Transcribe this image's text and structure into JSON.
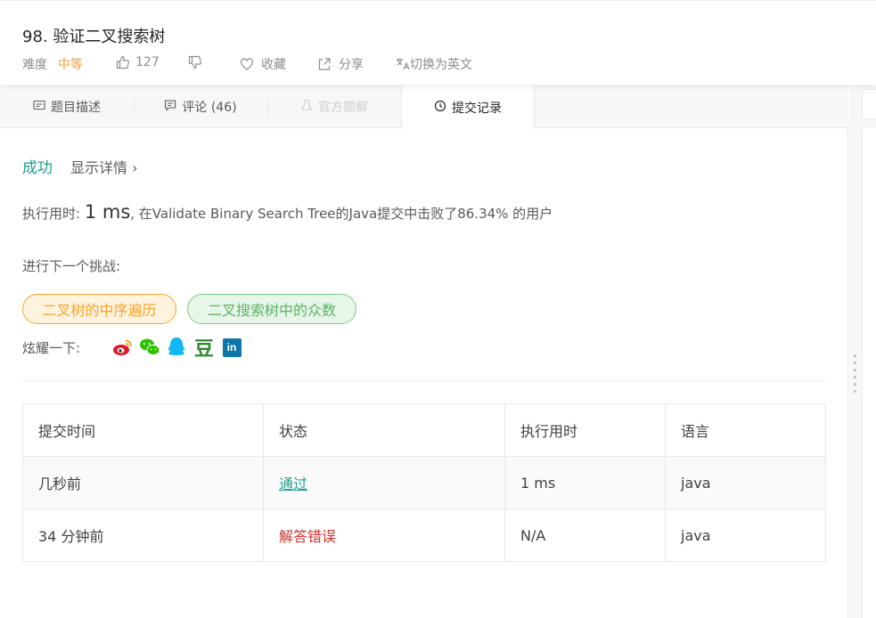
{
  "problem": {
    "title": "98. 验证二叉搜索树",
    "difficulty_label": "难度",
    "difficulty_value": "中等",
    "likes": "127",
    "favorite_label": "收藏",
    "share_label": "分享",
    "translate_label": "切换为英文"
  },
  "tabs": [
    {
      "label": "题目描述",
      "icon": "description-icon"
    },
    {
      "label": "评论 (46)",
      "icon": "comment-icon"
    },
    {
      "label": "官方题解",
      "icon": "solution-icon"
    },
    {
      "label": "提交记录",
      "icon": "clock-icon"
    }
  ],
  "result": {
    "status": "成功",
    "details_link": "显示详情 ›",
    "runtime_prefix": "执行用时: ",
    "runtime_value": "1 ms",
    "runtime_suffix": ", 在Validate Binary Search Tree的Java提交中击败了86.34% 的用户"
  },
  "next": {
    "label": "进行下一个挑战:",
    "challenges": [
      "二叉树的中序遍历",
      "二叉搜索树中的众数"
    ]
  },
  "share": {
    "label": "炫耀一下:",
    "icons": [
      "weibo-icon",
      "wechat-icon",
      "qq-icon",
      "douban-icon",
      "linkedin-icon"
    ],
    "douban_glyph": "豆",
    "linkedin_glyph": "in"
  },
  "submissions": {
    "headers": [
      "提交时间",
      "状态",
      "执行用时",
      "语言"
    ],
    "rows": [
      {
        "time": "几秒前",
        "status": "通过",
        "runtime": "1 ms",
        "lang": "java"
      },
      {
        "time": "34 分钟前",
        "status": "解答错误",
        "runtime": "N/A",
        "lang": "java"
      }
    ]
  },
  "colors": {
    "success": "#1e9e8c",
    "error": "#d0312d",
    "difficulty_medium": "#f49c3d",
    "pill_orange": "#f5a623",
    "pill_green": "#5cb366"
  }
}
